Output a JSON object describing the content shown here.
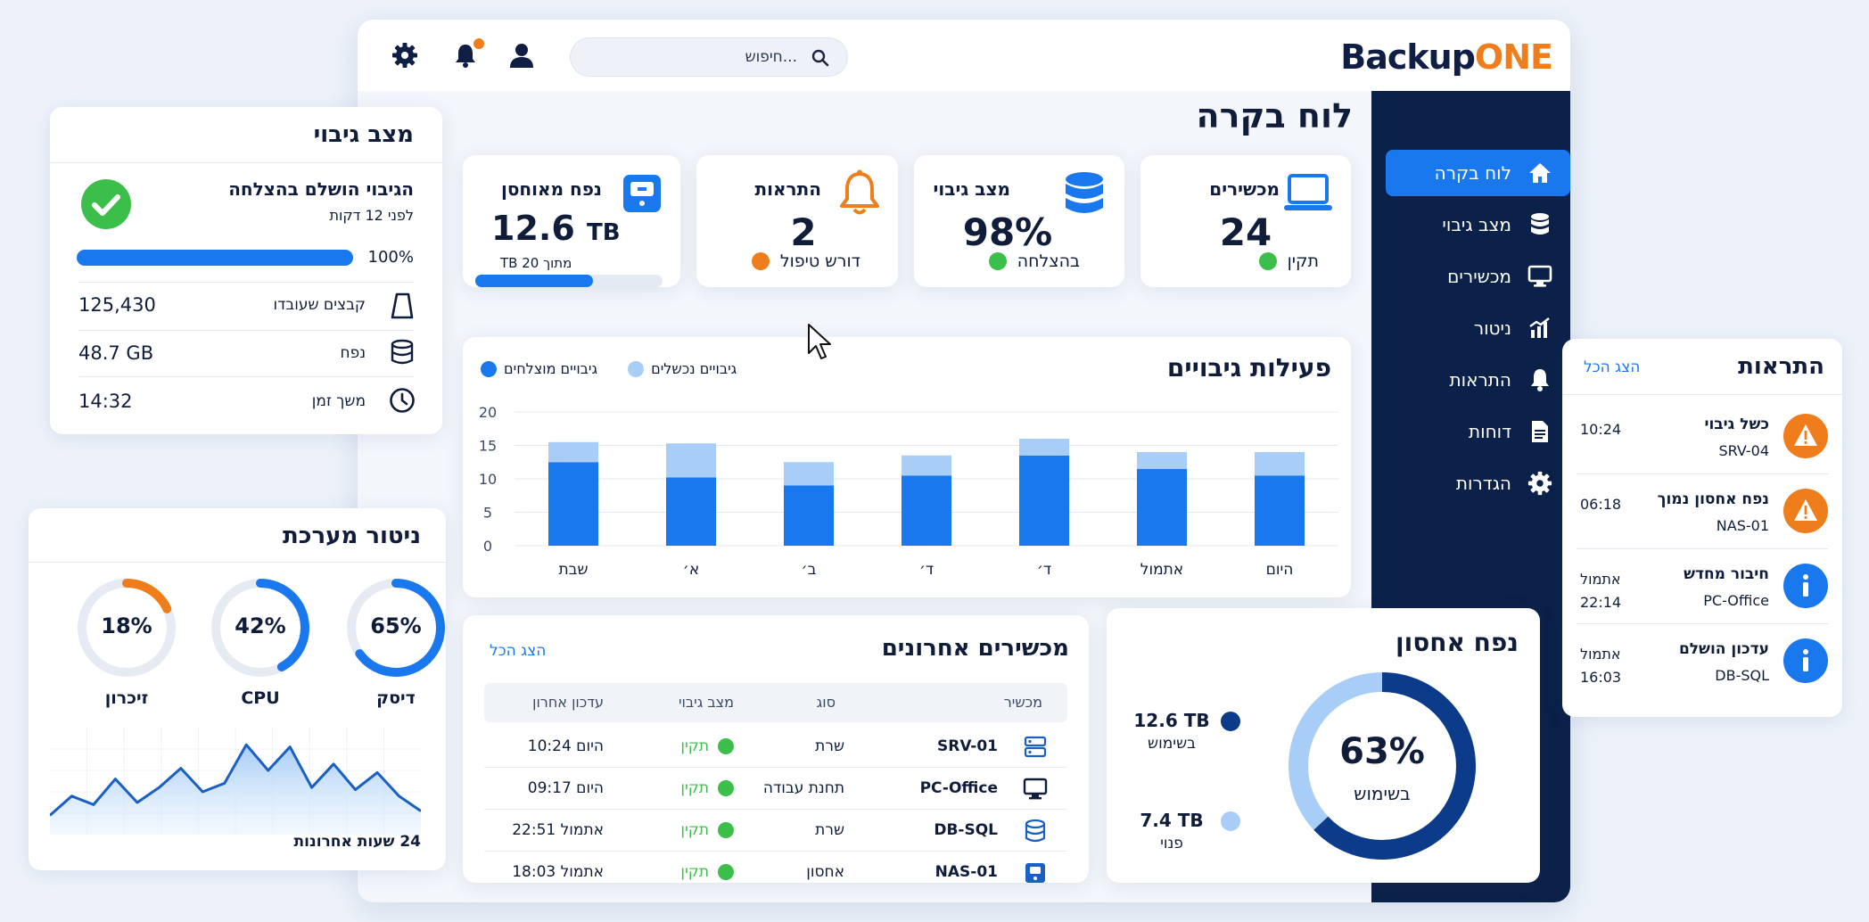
{
  "brand": {
    "part1": "Backup",
    "part2": "ONE"
  },
  "topbar": {
    "search_placeholder": "חיפוש..."
  },
  "page_title": "לוח בקרה",
  "sidebar": {
    "items": [
      {
        "label": "לוח בקרה",
        "icon": "home-icon",
        "active": true
      },
      {
        "label": "מצב גיבוי",
        "icon": "database-icon"
      },
      {
        "label": "מכשירים",
        "icon": "monitor-icon"
      },
      {
        "label": "ניטור",
        "icon": "chart-icon"
      },
      {
        "label": "התראות",
        "icon": "bell-icon"
      },
      {
        "label": "דוחות",
        "icon": "document-icon"
      },
      {
        "label": "הגדרות",
        "icon": "gear-icon"
      }
    ]
  },
  "stats": {
    "devices": {
      "title": "מכשירים",
      "value": "24",
      "status": "תקין",
      "status_color": "#3cbf4a"
    },
    "backup": {
      "title": "מצב גיבוי",
      "value": "98%",
      "status": "בהצלחה",
      "status_color": "#3cbf4a"
    },
    "alerts": {
      "title": "התראות",
      "value": "2",
      "status": "דורש טיפול",
      "status_color": "#f07d1c"
    },
    "storage": {
      "title": "נפח מאוחסן",
      "value_num": "12.6",
      "value_unit": "TB",
      "sub": "מתוך 20 TB",
      "fill": 0.63
    }
  },
  "backup_activity": {
    "title": "פעילות גיבויים",
    "legend": {
      "success": "גיבויים מוצלחים",
      "failed": "גיבויים נכשלים"
    }
  },
  "chart_data": {
    "type": "bar",
    "stacked": true,
    "categories": [
      "היום",
      "אתמול",
      "ד׳",
      "ד׳",
      "ב׳",
      "א׳",
      "שבת"
    ],
    "series": [
      {
        "name": "גיבויים מוצלחים",
        "color": "#1a78ef",
        "values": [
          10.5,
          11.5,
          13.5,
          10.5,
          9,
          10.2,
          12.5
        ]
      },
      {
        "name": "גיבויים נכשלים",
        "color": "#a8cef7",
        "values": [
          3.5,
          2.5,
          2.5,
          3,
          3.5,
          5.1,
          3
        ]
      }
    ],
    "ylim": [
      0,
      20
    ],
    "yticks": [
      "0",
      "5",
      "10",
      "15",
      "20"
    ]
  },
  "storage_panel": {
    "title": "נפח אחסון",
    "percent": "63%",
    "percent_value": 63,
    "center_label": "בשימוש",
    "used": {
      "value": "12.6 TB",
      "label": "בשימוש",
      "color": "#0c3b8a"
    },
    "free": {
      "value": "7.4 TB",
      "label": "פנוי",
      "color": "#a8cef7"
    }
  },
  "devices_panel": {
    "title": "מכשירים אחרונים",
    "view_all": "הצג הכל",
    "columns": [
      "מכשיר",
      "סוג",
      "מצב גיבוי",
      "עדכון אחרון"
    ],
    "rows": [
      {
        "name": "SRV-01",
        "type": "שרת",
        "status": "תקין",
        "updated": "היום 10:24",
        "icon": "server-icon"
      },
      {
        "name": "PC-Office",
        "type": "תחנת עבודה",
        "status": "תקין",
        "updated": "היום 09:17",
        "icon": "monitor-icon"
      },
      {
        "name": "DB-SQL",
        "type": "שרת",
        "status": "תקין",
        "updated": "אתמול 22:51",
        "icon": "database-icon"
      },
      {
        "name": "NAS-01",
        "type": "אחסון",
        "status": "תקין",
        "updated": "אתמול 18:03",
        "icon": "nas-icon"
      }
    ]
  },
  "backup_status": {
    "title": "מצב גיבוי",
    "headline": "הגיבוי הושלם בהצלחה",
    "subline": "לפני 12 דקות",
    "progress_label": "100%",
    "progress": 1.0,
    "rows": [
      {
        "label": "קבצים שעובדו",
        "value": "125,430",
        "icon": "file-icon"
      },
      {
        "label": "נפח",
        "value": "48.7 GB",
        "icon": "database-icon"
      },
      {
        "label": "משך זמן",
        "value": "14:32",
        "icon": "clock-icon"
      }
    ]
  },
  "system_monitor": {
    "title": "ניטור מערכת",
    "gauges": [
      {
        "label": "דיסק",
        "value": "65%",
        "fraction": 0.65,
        "color": "#1a78ef"
      },
      {
        "label": "CPU",
        "value": "42%",
        "fraction": 0.42,
        "color": "#1a78ef"
      },
      {
        "label": "זיכרון",
        "value": "18%",
        "fraction": 0.18,
        "color": "#f07d1c"
      }
    ],
    "sparkline": [
      18,
      36,
      28,
      52,
      30,
      44,
      62,
      40,
      48,
      84,
      60,
      82,
      44,
      66,
      42,
      58,
      36,
      22
    ],
    "caption": "24 שעות אחרונות"
  },
  "alerts_panel": {
    "title": "התראות",
    "view_all": "הצג הכל",
    "items": [
      {
        "title": "כשל גיבוי",
        "device": "SRV-04",
        "time1": "10:24",
        "time2": "",
        "level": "warning",
        "color": "#f07d1c"
      },
      {
        "title": "נפח אחסון נמוך",
        "device": "NAS-01",
        "time1": "06:18",
        "time2": "",
        "level": "warning",
        "color": "#f07d1c"
      },
      {
        "title": "חיבור מחדש",
        "device": "PC-Office",
        "time1": "אתמול",
        "time2": "22:14",
        "level": "info",
        "color": "#1a78ef"
      },
      {
        "title": "עדכון הושלם",
        "device": "DB-SQL",
        "time1": "אתמול",
        "time2": "16:03",
        "level": "info",
        "color": "#1a78ef"
      }
    ]
  }
}
